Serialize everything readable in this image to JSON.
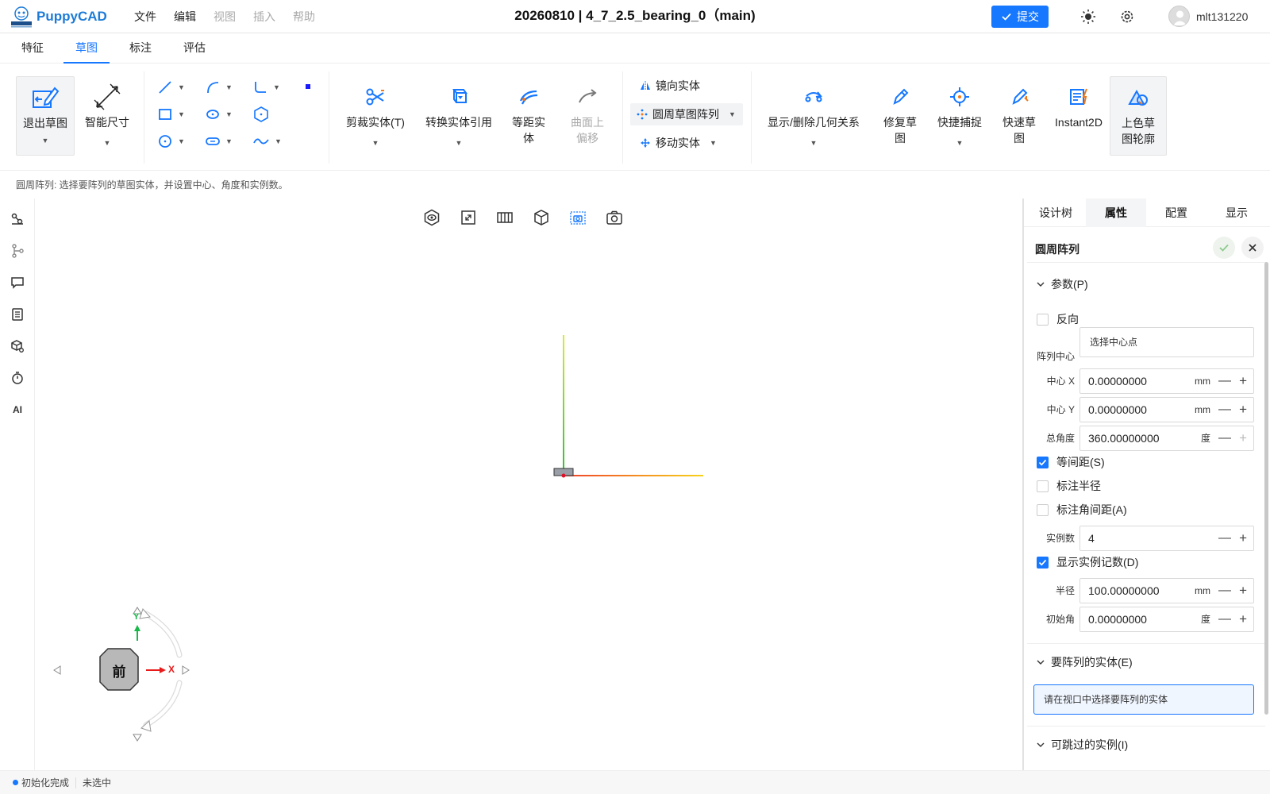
{
  "app": {
    "name": "PuppyCAD",
    "doc_title": "20260810 | 4_7_2.5_bearing_0（main)",
    "menu": [
      "文件",
      "编辑",
      "视图",
      "插入",
      "帮助"
    ],
    "submit_label": "提交",
    "username": "mlt131220",
    "accent": "#1677ff"
  },
  "tabs": [
    "特征",
    "草图",
    "标注",
    "评估"
  ],
  "ribbon": {
    "exit_sketch": "退出草图",
    "smart_dim": "智能尺寸",
    "trim": "剪裁实体(T)",
    "convert": "转换实体引用",
    "offset_l1": "等距实",
    "offset_l2": "体",
    "surface_offset_l1": "曲面上",
    "surface_offset_l2": "偏移",
    "mirror": "镜向实体",
    "circular_pattern": "圆周草图阵列",
    "move": "移动实体",
    "relations": "显示/删除几何关系",
    "repair_l1": "修复草",
    "repair_l2": "图",
    "quick_snap": "快捷捕捉",
    "quick_sketch_l1": "快速草",
    "quick_sketch_l2": "图",
    "instant2d": "Instant2D",
    "shaded_l1": "上色草",
    "shaded_l2": "图轮廓"
  },
  "hint": "圆周阵列: 选择要阵列的草图实体，并设置中心、角度和实例数。",
  "left_sidebar": [
    "ai_label"
  ],
  "left_ai_label": "AI",
  "navcube": {
    "face": "前",
    "x": "X",
    "y": "Y"
  },
  "panel": {
    "tabs": [
      "设计树",
      "属性",
      "配置",
      "显示"
    ],
    "title": "圆周阵列",
    "params_header": "参数(P)",
    "reverse": "反向",
    "center_label": "阵列中心",
    "center_placeholder": "选择中心点",
    "fields": {
      "cx": {
        "label": "中心 X",
        "value": "0.00000000",
        "unit": "mm"
      },
      "cy": {
        "label": "中心 Y",
        "value": "0.00000000",
        "unit": "mm"
      },
      "angle": {
        "label": "总角度",
        "value": "360.00000000",
        "unit": "度"
      },
      "count": {
        "label": "实例数",
        "value": "4"
      },
      "radius": {
        "label": "半径",
        "value": "100.00000000",
        "unit": "mm"
      },
      "start": {
        "label": "初始角",
        "value": "0.00000000",
        "unit": "度"
      }
    },
    "equal_spacing": "等间距(S)",
    "dim_radius": "标注半径",
    "dim_angle": "标注角间距(A)",
    "show_count": "显示实例记数(D)",
    "entities_header": "要阵列的实体(E)",
    "entities_hint": "请在视口中选择要阵列的实体",
    "skip_header": "可跳过的实例(I)"
  },
  "status": {
    "init": "初始化完成",
    "selection": "未选中"
  }
}
